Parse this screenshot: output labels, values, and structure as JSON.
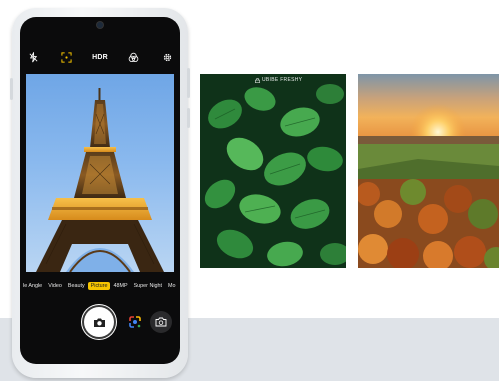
{
  "camera": {
    "hdr_label": "HDR",
    "modes": [
      "le Angle",
      "Video",
      "Beauty",
      "Picture",
      "48MP",
      "Super Night",
      "Mo"
    ],
    "active_mode": "Picture",
    "accent_color": "#f5c400"
  },
  "gallery": {
    "mint_watermark": "UBIBE FRESHY",
    "watermark_icon": "lock-icon"
  },
  "icons": [
    "flash-off-icon",
    "focus-frame-icon",
    "hdr-icon",
    "filter-icon",
    "settings-gear-icon",
    "camera-icon",
    "google-lens-icon",
    "switch-camera-icon"
  ]
}
